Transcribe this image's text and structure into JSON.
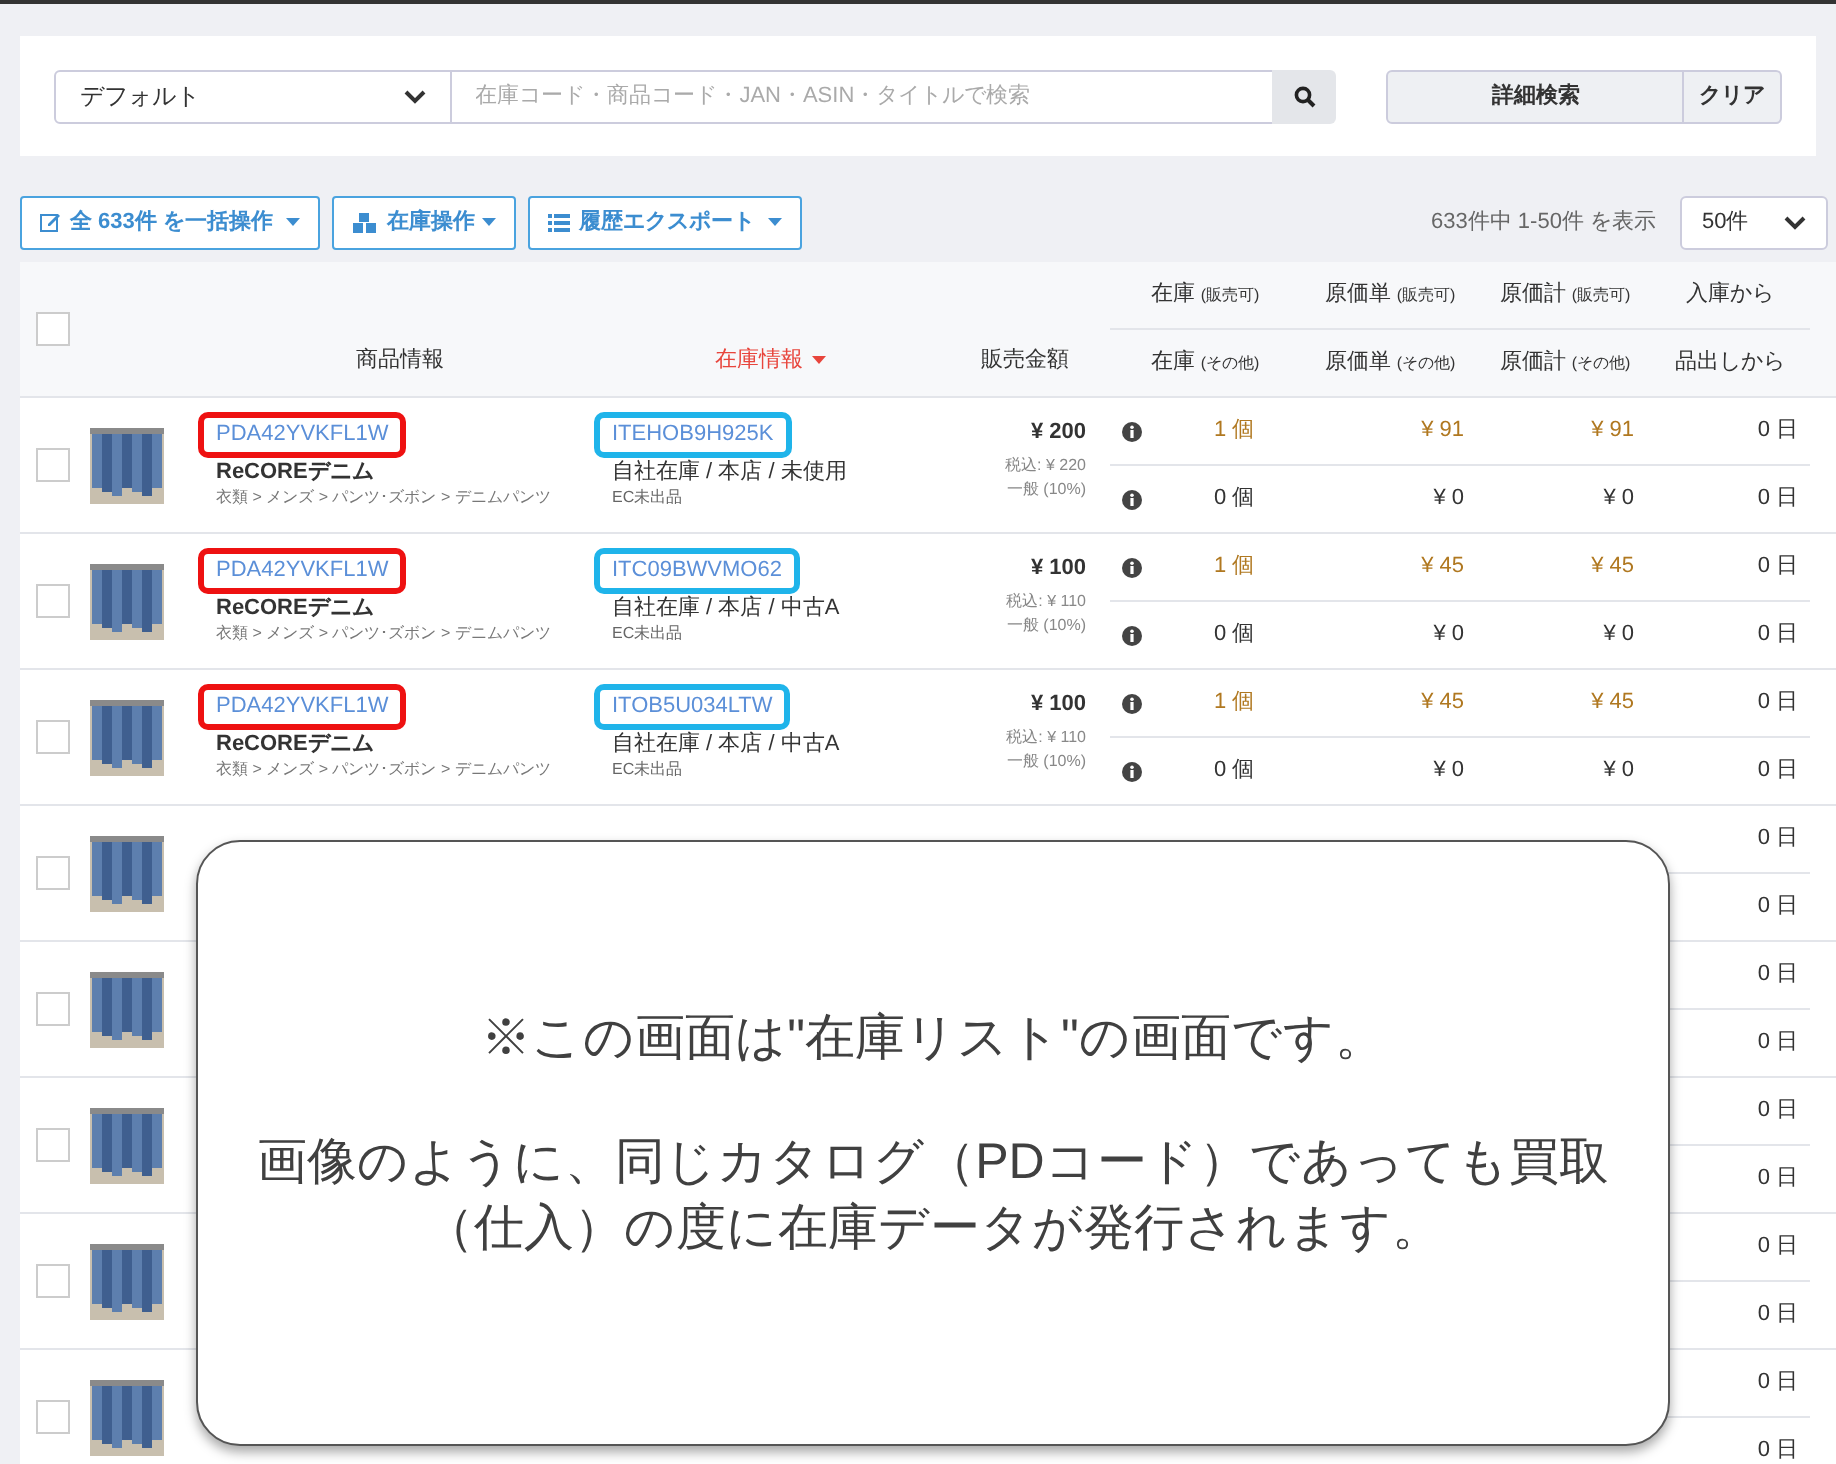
{
  "search": {
    "preset": "デフォルト",
    "placeholder": "在庫コード・商品コード・JAN・ASIN・タイトルで検索",
    "advanced_button": "詳細検索",
    "clear_button": "クリア"
  },
  "toolbar": {
    "bulk_button": "全 633件 を一括操作",
    "stock_button": "在庫操作",
    "export_button": "履歴エクスポート",
    "range_text": "633件中 1-50件 を表示",
    "page_size": "50件"
  },
  "table": {
    "select_all_checked": false,
    "columns": {
      "product": "商品情報",
      "stock": {
        "label": "在庫情報",
        "sorted": true
      },
      "price": "販売金額",
      "right_top": [
        {
          "label": "在庫",
          "note": "(販売可)"
        },
        {
          "label": "原価単",
          "note": "(販売可)"
        },
        {
          "label": "原価計",
          "note": "(販売可)"
        },
        {
          "label": "入庫から"
        }
      ],
      "right_bottom": [
        {
          "label": "在庫",
          "note": "(その他)"
        },
        {
          "label": "原価単",
          "note": "(その他)"
        },
        {
          "label": "原価計",
          "note": "(その他)"
        },
        {
          "label": "品出しから"
        }
      ]
    },
    "rows": [
      {
        "kind": "full",
        "checked": false,
        "product": {
          "code": "PDA42YVKFL1W",
          "highlighted": true,
          "name": "ReCOREデニム",
          "category": "衣類 > メンズ > パンツ･ズボン > デニムパンツ"
        },
        "stock": {
          "code": "ITEHOB9H925K",
          "highlighted": true,
          "location": "自社在庫 / 本店 / 未使用",
          "ec": "EC未出品"
        },
        "price": {
          "amount": "¥ 200",
          "tax_incl": "税込: ¥ 220",
          "tax_class": "一般 (10%)"
        },
        "sellable": {
          "qty": "1 個",
          "unit_cost": "¥ 91",
          "total_cost": "¥ 91",
          "days": "0 日"
        },
        "other": {
          "qty": "0 個",
          "unit_cost": "¥ 0",
          "total_cost": "¥ 0",
          "days": "0 日"
        }
      },
      {
        "kind": "full",
        "checked": false,
        "product": {
          "code": "PDA42YVKFL1W",
          "highlighted": true,
          "name": "ReCOREデニム",
          "category": "衣類 > メンズ > パンツ･ズボン > デニムパンツ"
        },
        "stock": {
          "code": "ITC09BWVMO62",
          "highlighted": true,
          "location": "自社在庫 / 本店 / 中古A",
          "ec": "EC未出品"
        },
        "price": {
          "amount": "¥ 100",
          "tax_incl": "税込: ¥ 110",
          "tax_class": "一般 (10%)"
        },
        "sellable": {
          "qty": "1 個",
          "unit_cost": "¥ 45",
          "total_cost": "¥ 45",
          "days": "0 日"
        },
        "other": {
          "qty": "0 個",
          "unit_cost": "¥ 0",
          "total_cost": "¥ 0",
          "days": "0 日"
        }
      },
      {
        "kind": "full",
        "checked": false,
        "product": {
          "code": "PDA42YVKFL1W",
          "highlighted": true,
          "name": "ReCOREデニム",
          "category": "衣類 > メンズ > パンツ･ズボン > デニムパンツ"
        },
        "stock": {
          "code": "ITOB5U034LTW",
          "highlighted": true,
          "location": "自社在庫 / 本店 / 中古A",
          "ec": "EC未出品"
        },
        "price": {
          "amount": "¥ 100",
          "tax_incl": "税込: ¥ 110",
          "tax_class": "一般 (10%)"
        },
        "sellable": {
          "qty": "1 個",
          "unit_cost": "¥ 45",
          "total_cost": "¥ 45",
          "days": "0 日"
        },
        "other": {
          "qty": "0 個",
          "unit_cost": "¥ 0",
          "total_cost": "¥ 0",
          "days": "0 日"
        }
      },
      {
        "kind": "covered",
        "checked": false,
        "sellable": {
          "days": "0 日"
        },
        "other": {
          "days": "0 日"
        }
      },
      {
        "kind": "covered",
        "checked": false,
        "sellable": {
          "days": "0 日"
        },
        "other": {
          "days": "0 日"
        }
      },
      {
        "kind": "covered",
        "checked": false,
        "sellable": {
          "days": "0 日"
        },
        "other": {
          "days": "0 日"
        }
      },
      {
        "kind": "covered",
        "checked": false,
        "sellable": {
          "days": "0 日"
        },
        "other": {
          "days": "0 日"
        }
      },
      {
        "kind": "covered",
        "checked": false,
        "sellable": {
          "days": "0 日"
        },
        "other": {
          "days": "0 日"
        }
      }
    ]
  },
  "callout": {
    "note": "※この画面は\"在庫リスト\"の画面です。",
    "message": "画像のように、同じカタログ（PDコード）であっても買取（仕入）の度に在庫データが発行されます。"
  }
}
